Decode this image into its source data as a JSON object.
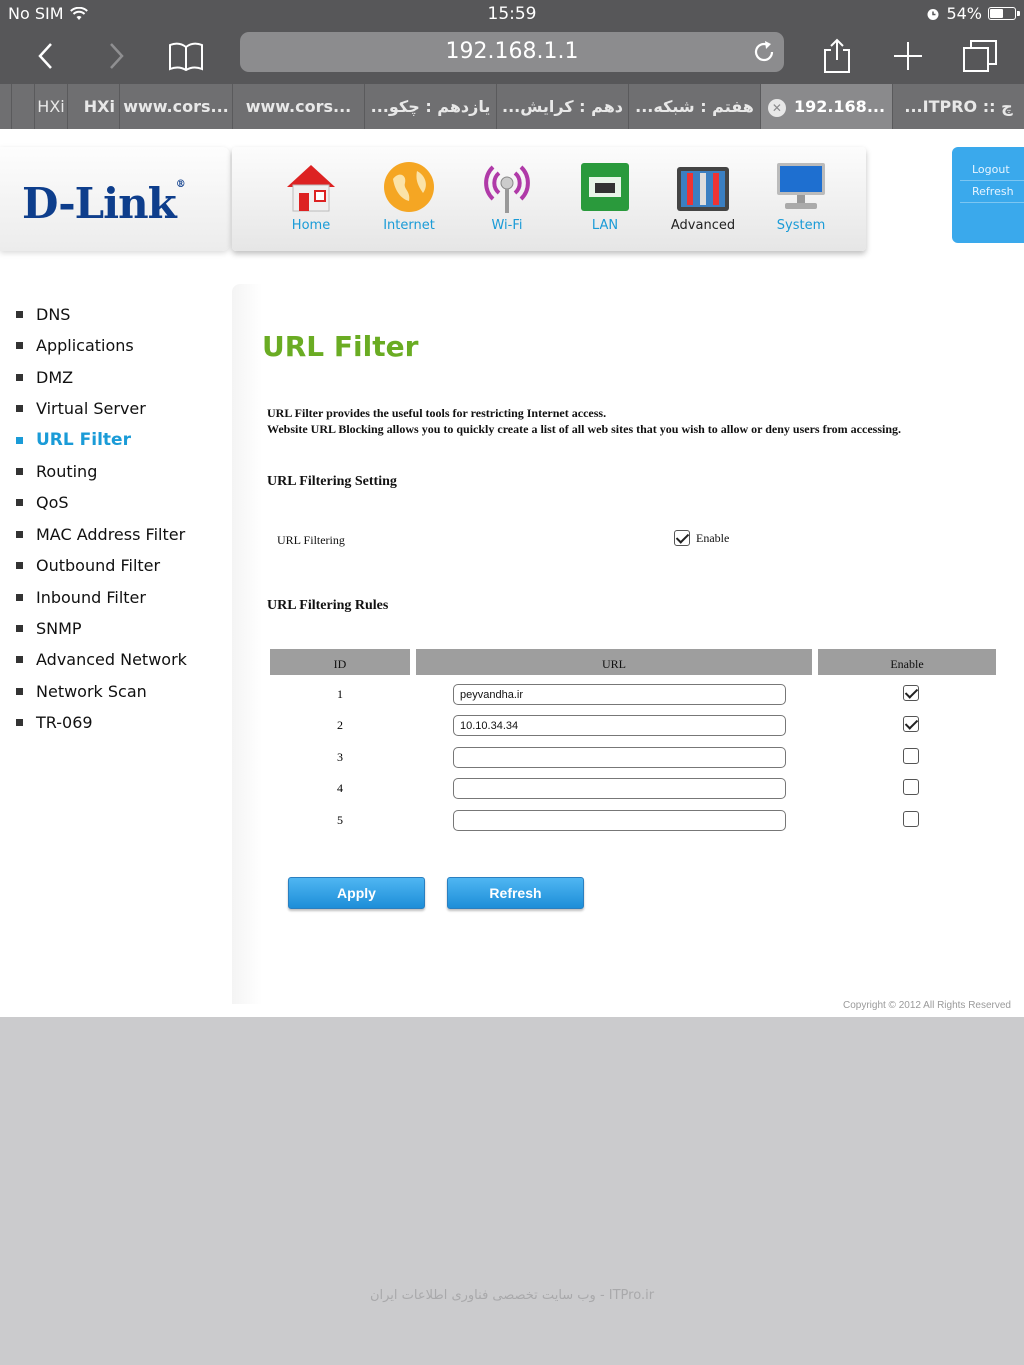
{
  "status": {
    "carrier": "No SIM",
    "time": "15:59",
    "battery": "54%",
    "battery_level": 0.54
  },
  "browser": {
    "address": "192.168.1.1"
  },
  "tabs": [
    {
      "label": "",
      "active": false
    },
    {
      "label": "",
      "active": false
    },
    {
      "label": "HXi",
      "active": false
    },
    {
      "label": "www.cors...",
      "active": false
    },
    {
      "label": "www.cors...",
      "active": false
    },
    {
      "label": "...یازدهم : چکو",
      "active": false
    },
    {
      "label": "...دهم : کرایش",
      "active": false
    },
    {
      "label": "...هفتم : شبکه",
      "active": false
    },
    {
      "label": "192.168...",
      "active": true
    },
    {
      "label": "...ITPRO :: چ",
      "active": false
    }
  ],
  "brand": {
    "logo": "D-Link",
    "mark": "®"
  },
  "nav": [
    {
      "label": "Home",
      "icon": "home-icon"
    },
    {
      "label": "Internet",
      "icon": "globe-icon"
    },
    {
      "label": "Wi-Fi",
      "icon": "wifi-icon"
    },
    {
      "label": "LAN",
      "icon": "lan-icon"
    },
    {
      "label": "Advanced",
      "icon": "tools-icon",
      "selected": true
    },
    {
      "label": "System",
      "icon": "monitor-icon"
    }
  ],
  "account": {
    "logout": "Logout",
    "refresh": "Refresh"
  },
  "sidebar": [
    "DNS",
    "Applications",
    "DMZ",
    "Virtual Server",
    "URL Filter",
    "Routing",
    "QoS",
    "MAC Address Filter",
    "Outbound Filter",
    "Inbound Filter",
    "SNMP",
    "Advanced Network",
    "Network Scan",
    "TR-069"
  ],
  "sidebar_active": "URL Filter",
  "content": {
    "title": "URL Filter",
    "desc1": "URL Filter provides the useful tools for restricting Internet access.",
    "desc2": "Website URL Blocking allows you to quickly create a list of all web sites that you wish to allow or deny users from accessing.",
    "setting_heading": "URL Filtering Setting",
    "filtering_label": "URL Filtering",
    "enable_label": "Enable",
    "filtering_enabled": true,
    "rules_heading": "URL Filtering Rules",
    "columns": [
      "ID",
      "URL",
      "Enable"
    ],
    "rules": [
      {
        "id": "1",
        "url": "peyvandha.ir",
        "enabled": true
      },
      {
        "id": "2",
        "url": "10.10.34.34",
        "enabled": true
      },
      {
        "id": "3",
        "url": "",
        "enabled": false
      },
      {
        "id": "4",
        "url": "",
        "enabled": false
      },
      {
        "id": "5",
        "url": "",
        "enabled": false
      }
    ],
    "apply_label": "Apply",
    "refresh_label": "Refresh"
  },
  "copyright": "Copyright © 2012  All Rights Reserved",
  "watermark": "وب سایت تخصصی فناوری اطلاعات ایران - ITPro.ir",
  "colors": {
    "accent": "#1a9bd7",
    "title_green": "#6aac23",
    "logo_blue": "#0e3e8c"
  }
}
